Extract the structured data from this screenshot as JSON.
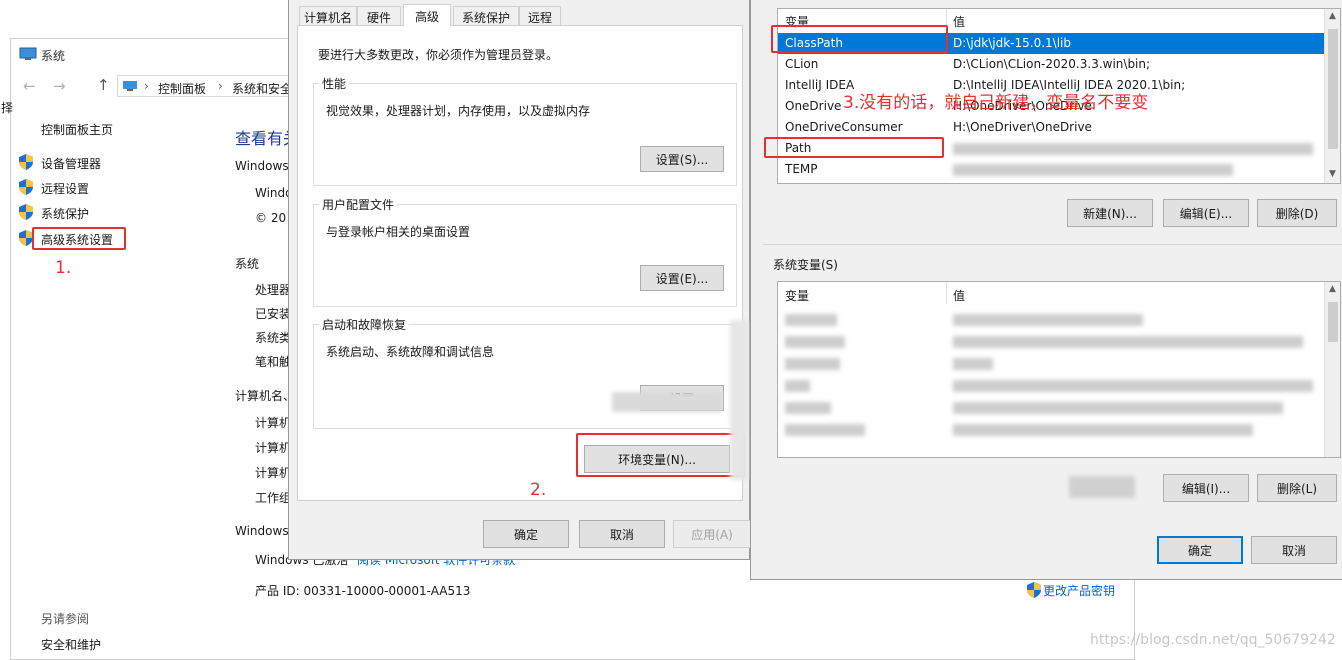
{
  "system_window": {
    "title": "系统",
    "address_path": [
      "控制面板",
      "系统和安全"
    ],
    "nav_home": "控制面板主页",
    "nav_items": [
      "设备管理器",
      "远程设置",
      "系统保护",
      "高级系统设置"
    ],
    "see_also_heading": "另请参阅",
    "see_also_item": "安全和维护",
    "main_heading": "查看有关",
    "windows_section_label": "Windows",
    "windows_edition_partial": "Windo",
    "copyright_partial": "© 20",
    "system_section_label": "系统",
    "system_rows": [
      "处理器",
      "已安装",
      "系统类",
      "笔和触"
    ],
    "computer_section_label": "计算机名、",
    "computer_rows": [
      "计算机",
      "计算机",
      "计算机",
      "工作组"
    ],
    "activation_section_label": "Windows",
    "activation_text": "Windows 已激活",
    "license_link": "阅读 Microsoft 软件许可条款",
    "product_id": "产品 ID: 00331-10000-00001-AA513",
    "change_key_link": "更改产品密钥",
    "left_edge_text": "择"
  },
  "sysprop_dialog": {
    "tabs": [
      "计算机名",
      "硬件",
      "高级",
      "系统保护",
      "远程"
    ],
    "active_tab": "高级",
    "admin_note": "要进行大多数更改，你必须作为管理员登录。",
    "groups": [
      {
        "title": "性能",
        "desc": "视觉效果，处理器计划，内存使用，以及虚拟内存",
        "button": "设置(S)..."
      },
      {
        "title": "用户配置文件",
        "desc": "与登录帐户相关的桌面设置",
        "button": "设置(E)..."
      },
      {
        "title": "启动和故障恢复",
        "desc": "系统启动、系统故障和调试信息",
        "button": "设置"
      }
    ],
    "env_button": "环境变量(N)...",
    "ok": "确定",
    "cancel": "取消",
    "apply": "应用(A)"
  },
  "env_dialog": {
    "user_vars": {
      "col_var": "变量",
      "col_val": "值",
      "rows": [
        {
          "name": "ClassPath",
          "value": "D:\\jdk\\jdk-15.0.1\\lib"
        },
        {
          "name": "CLion",
          "value": "D:\\CLion\\CLion-2020.3.3.win\\bin;"
        },
        {
          "name": "IntelliJ IDEA",
          "value": "D:\\IntelliJ IDEA\\IntelliJ IDEA 2020.1\\bin;"
        },
        {
          "name": "OneDrive",
          "value": "H:\\OneDriver\\OneDrive"
        },
        {
          "name": "OneDriveConsumer",
          "value": "H:\\OneDriver\\OneDrive"
        },
        {
          "name": "Path",
          "value": ""
        },
        {
          "name": "TEMP",
          "value": ""
        }
      ],
      "new_btn": "新建(N)...",
      "edit_btn": "编辑(E)...",
      "delete_btn": "删除(D)"
    },
    "sys_vars": {
      "label": "系统变量(S)",
      "col_var": "变量",
      "col_val": "值",
      "edit_btn": "编辑(I)...",
      "delete_btn": "删除(L)"
    },
    "ok": "确定",
    "cancel": "取消"
  },
  "annotations": {
    "step1": "1.",
    "step2": "2.",
    "step3": "3.没有的话，就自己新建，变量名不要变"
  },
  "watermark": "https://blog.csdn.net/qq_50679242"
}
